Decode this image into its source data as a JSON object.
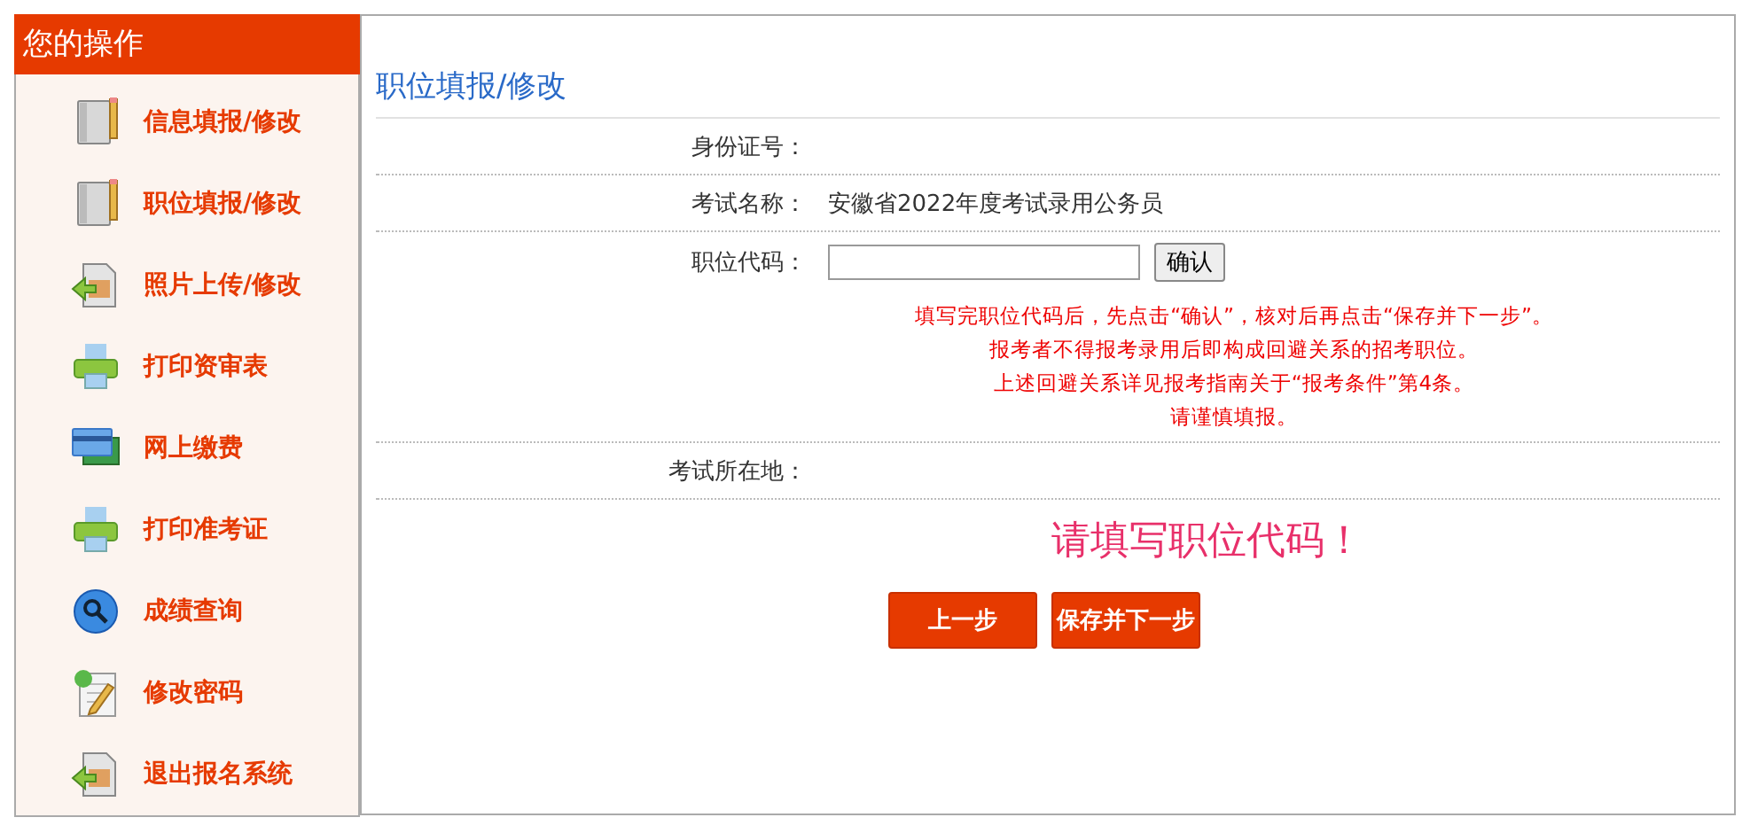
{
  "sidebar": {
    "title": "您的操作",
    "items": [
      {
        "label": "信息填报/修改"
      },
      {
        "label": "职位填报/修改"
      },
      {
        "label": "照片上传/修改"
      },
      {
        "label": "打印资审表"
      },
      {
        "label": "网上缴费"
      },
      {
        "label": "打印准考证"
      },
      {
        "label": "成绩查询"
      },
      {
        "label": "修改密码"
      },
      {
        "label": "退出报名系统"
      }
    ]
  },
  "form": {
    "title": "职位填报/修改",
    "id_label": "身份证号：",
    "exam_label": "考试名称：",
    "exam_value": "安徽省2022年度考试录用公务员",
    "code_label": "职位代码：",
    "confirm_button": "确认",
    "notes": [
      "填写完职位代码后，先点击“确认”，核对后再点击“保存并下一步”。",
      "报考者不得报考录用后即构成回避关系的招考职位。",
      "上述回避关系详见报考指南关于“报考条件”第4条。",
      "请谨慎填报。"
    ],
    "location_label": "考试所在地：",
    "warning": "请填写职位代码！",
    "buttons": [
      "上一步",
      "保存并下一步"
    ]
  }
}
